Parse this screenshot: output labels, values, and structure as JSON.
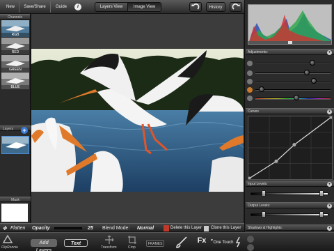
{
  "topbar": {
    "new_label": "New",
    "saveshare_label": "Save/Share",
    "guide_label": "Guide",
    "info_glyph": "i",
    "view_tabs": [
      {
        "label": "Layers View"
      },
      {
        "label": "Image View"
      }
    ],
    "history_label": "History"
  },
  "left_panel": {
    "channels_title": "Channels",
    "channels": [
      {
        "label": "RGB"
      },
      {
        "label": "RED"
      },
      {
        "label": "GREEN"
      },
      {
        "label": "BLUE"
      }
    ],
    "layers_title": "Layers",
    "add_layer_glyph": "+",
    "mask_title": "Mask"
  },
  "right_panel": {
    "adjustments_title": "Adjustments:",
    "curves_title": "Curves",
    "input_levels_title": "Input Levels:",
    "output_levels_title": "Output Levels:",
    "shadows_title": "Shadows & Highlights:",
    "adjustments": [
      {
        "icon": "brightness-icon",
        "level": 0.78
      },
      {
        "icon": "contrast-icon",
        "level": 0.7
      },
      {
        "icon": "saturation-icon",
        "level": 0.8
      },
      {
        "icon": "hue-icon",
        "level": 0.05
      },
      {
        "icon": "temperature-icon",
        "level": 0.55
      }
    ],
    "curve_points": [
      [
        0.0,
        0.0
      ],
      [
        0.33,
        0.28
      ],
      [
        0.55,
        0.55
      ],
      [
        1.0,
        1.0
      ]
    ]
  },
  "propbar": {
    "flatten_label": "Flatten",
    "opacity_label": "Opacity",
    "opacity_value": "25",
    "blend_label": "Blend Mode:",
    "blend_value": "Normal",
    "delete_label": "Delete this Layer",
    "clone_label": "Clone this Layer"
  },
  "toolbar": {
    "app_name": "FlipRonnie",
    "add_layers_label": "Add Layers",
    "text_label": "Text",
    "transform_label": "Transform",
    "crop_label": "Crop",
    "frames_label": "FRAMES",
    "fx_label": "Fx",
    "one_touch_label": "One Touch"
  },
  "colors": {
    "accent": "#3a7bd5",
    "delete_red": "#c0392b",
    "sky": "#dfe6d8",
    "water": "#2f5d86"
  }
}
